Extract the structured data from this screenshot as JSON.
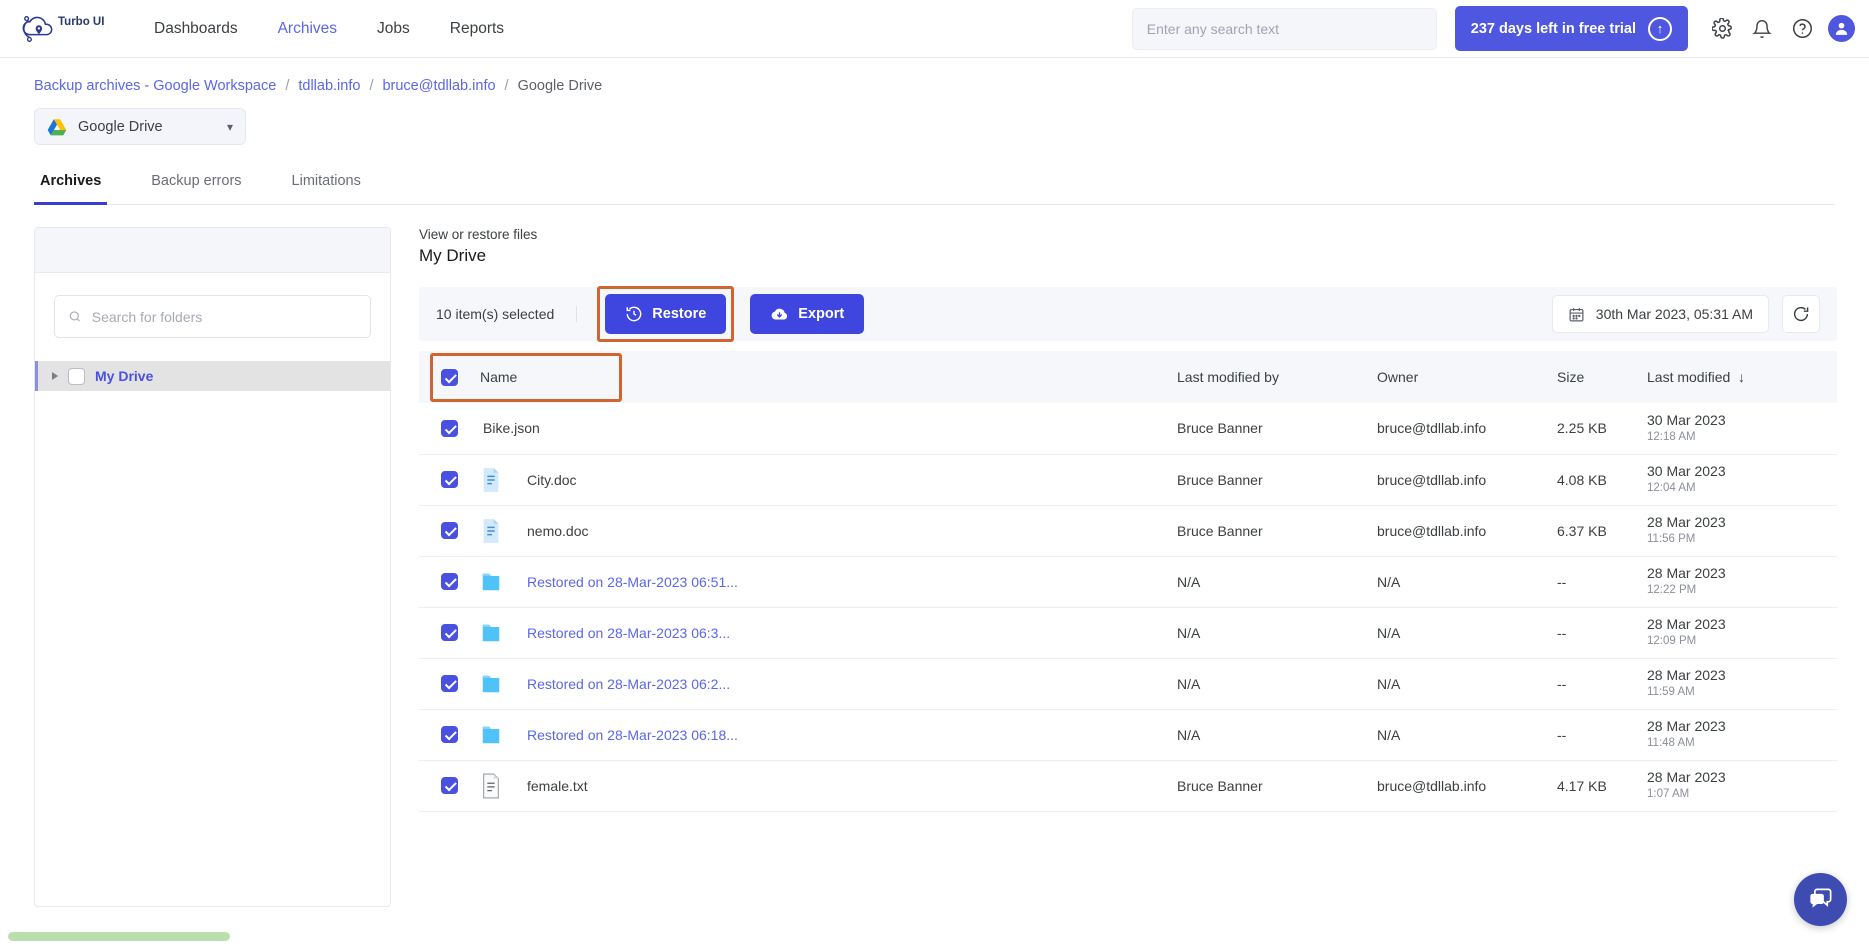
{
  "app": {
    "name": "Turbo UI",
    "logo_icon": "cloud-location-logo"
  },
  "nav": {
    "links": [
      {
        "label": "Dashboards",
        "active": false
      },
      {
        "label": "Archives",
        "active": true
      },
      {
        "label": "Jobs",
        "active": false
      },
      {
        "label": "Reports",
        "active": false
      }
    ],
    "search": {
      "placeholder": "Enter any search text",
      "value": "",
      "icon": "search-icon"
    },
    "trial": {
      "label": "237 days left in free trial",
      "icon": "upgrade-arrow-up-icon"
    },
    "icons": [
      "gear-icon",
      "bell-icon",
      "help-circle-icon",
      "user-avatar-icon"
    ]
  },
  "breadcrumb": {
    "items": [
      {
        "label": "Backup archives - Google Workspace",
        "current": false
      },
      {
        "label": "tdllab.info",
        "current": false
      },
      {
        "label": "bruce@tdllab.info",
        "current": false
      },
      {
        "label": "Google Drive",
        "current": true
      }
    ],
    "separator": "/"
  },
  "service_select": {
    "label": "Google Drive",
    "icon": "google-drive-icon",
    "chevron": "chevron-down-icon"
  },
  "tabs": [
    {
      "label": "Archives",
      "active": true
    },
    {
      "label": "Backup errors",
      "active": false
    },
    {
      "label": "Limitations",
      "active": false
    }
  ],
  "folder_panel": {
    "search": {
      "placeholder": "Search for folders",
      "value": "",
      "icon": "search-icon"
    },
    "tree": [
      {
        "label": "My Drive",
        "checked": false,
        "expander": "triangle-right-icon"
      }
    ]
  },
  "main": {
    "view_label": "View or restore files",
    "title": "My Drive",
    "toolbar": {
      "selection_count": "10 item(s) selected",
      "restore_label": "Restore",
      "restore_icon": "restore-clock-icon",
      "export_label": "Export",
      "export_icon": "cloud-download-icon",
      "date_value": "30th Mar 2023, 05:31 AM",
      "date_icon": "calendar-icon",
      "refresh_icon": "refresh-icon"
    },
    "table": {
      "headers": [
        "Name",
        "Last modified by",
        "Owner",
        "Size",
        "Last modified"
      ],
      "sort_icon": "arrow-down-icon",
      "select_all_checked": true,
      "rows": [
        {
          "checked": true,
          "icon": "",
          "name": "Bike.json",
          "is_link": false,
          "modified_by": "Bruce Banner",
          "owner": "bruce@tdllab.info",
          "size": "2.25 KB",
          "date": "30 Mar 2023",
          "time": "12:18 AM"
        },
        {
          "checked": true,
          "icon": "doc-file-icon",
          "name": "City.doc",
          "is_link": false,
          "modified_by": "Bruce Banner",
          "owner": "bruce@tdllab.info",
          "size": "4.08 KB",
          "date": "30 Mar 2023",
          "time": "12:04 AM"
        },
        {
          "checked": true,
          "icon": "doc-file-icon",
          "name": "nemo.doc",
          "is_link": false,
          "modified_by": "Bruce Banner",
          "owner": "bruce@tdllab.info",
          "size": "6.37 KB",
          "date": "28 Mar 2023",
          "time": "11:56 PM"
        },
        {
          "checked": true,
          "icon": "folder-icon",
          "name": "Restored on 28-Mar-2023 06:51...",
          "is_link": true,
          "modified_by": "N/A",
          "owner": "N/A",
          "size": "--",
          "date": "28 Mar 2023",
          "time": "12:22 PM"
        },
        {
          "checked": true,
          "icon": "folder-icon",
          "name": "Restored on 28-Mar-2023 06:3...",
          "is_link": true,
          "modified_by": "N/A",
          "owner": "N/A",
          "size": "--",
          "date": "28 Mar 2023",
          "time": "12:09 PM"
        },
        {
          "checked": true,
          "icon": "folder-icon",
          "name": "Restored on 28-Mar-2023 06:2...",
          "is_link": true,
          "modified_by": "N/A",
          "owner": "N/A",
          "size": "--",
          "date": "28 Mar 2023",
          "time": "11:59 AM"
        },
        {
          "checked": true,
          "icon": "folder-icon",
          "name": "Restored on 28-Mar-2023 06:18...",
          "is_link": true,
          "modified_by": "N/A",
          "owner": "N/A",
          "size": "--",
          "date": "28 Mar 2023",
          "time": "11:48 AM"
        },
        {
          "checked": true,
          "icon": "txt-file-icon",
          "name": "female.txt",
          "is_link": false,
          "modified_by": "Bruce Banner",
          "owner": "bruce@tdllab.info",
          "size": "4.17 KB",
          "date": "28 Mar 2023",
          "time": "1:07 AM"
        }
      ]
    }
  },
  "chat": {
    "icon": "chat-bubble-icon"
  },
  "colors": {
    "accent": "#4f56e0",
    "link": "#5a67e8",
    "highlight_box": "#d2652f",
    "scrollbar": "#b9e0ac"
  }
}
